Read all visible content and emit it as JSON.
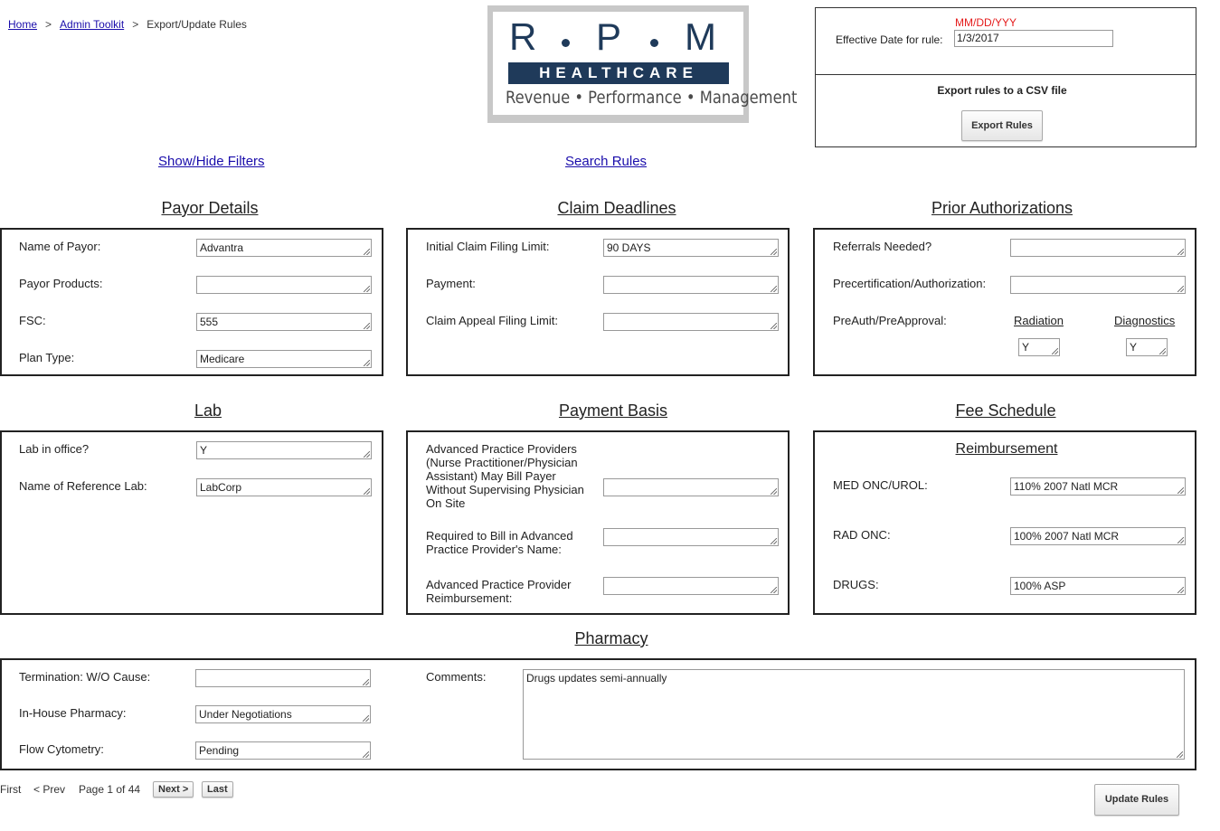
{
  "breadcrumb": {
    "home": "Home",
    "admin": "Admin Toolkit",
    "current": "Export/Update Rules",
    "sep": ">"
  },
  "logo": {
    "letters": [
      "R",
      "P",
      "M"
    ],
    "band": "HEALTHCARE",
    "tagline": "Revenue • Performance • Management"
  },
  "export": {
    "date_format": "MM/DD/YYY",
    "effective_label": "Effective Date for rule:",
    "effective_value": "1/3/2017",
    "csv_label": "Export rules to a CSV file",
    "export_button": "Export Rules"
  },
  "links": {
    "filters": "Show/Hide Filters",
    "search": "Search Rules"
  },
  "payor": {
    "title": "Payor Details",
    "fields": [
      {
        "label": "Name of Payor:",
        "value": "Advantra"
      },
      {
        "label": "Payor Products:",
        "value": ""
      },
      {
        "label": "FSC:",
        "value": "555"
      },
      {
        "label": "Plan Type:",
        "value": "Medicare"
      }
    ]
  },
  "claim": {
    "title": "Claim Deadlines",
    "fields": [
      {
        "label": "Initial Claim Filing Limit:",
        "value": "90 DAYS"
      },
      {
        "label": "Payment:",
        "value": ""
      },
      {
        "label": "Claim Appeal Filing Limit:",
        "value": ""
      }
    ]
  },
  "prior": {
    "title": "Prior Authorizations",
    "referrals_label": "Referrals Needed?",
    "referrals_value": "",
    "precert_label": "Precertification/Authorization:",
    "precert_value": "",
    "preauth_label": "PreAuth/PreApproval:",
    "radiation_label": "Radiation",
    "radiation_value": "Y",
    "diagnostics_label": "Diagnostics",
    "diagnostics_value": "Y"
  },
  "lab": {
    "title": "Lab",
    "fields": [
      {
        "label": "Lab in office?",
        "value": "Y"
      },
      {
        "label": "Name of Reference Lab:",
        "value": "LabCorp"
      }
    ]
  },
  "payment_basis": {
    "title": "Payment Basis",
    "fields": [
      {
        "label": "Advanced Practice Providers (Nurse Practitioner/Physician Assistant) May Bill Payer Without Supervising Physician On Site",
        "value": ""
      },
      {
        "label": "Required to Bill in Advanced Practice Provider's Name:",
        "value": ""
      },
      {
        "label": "Advanced Practice Provider Reimbursement:",
        "value": ""
      }
    ]
  },
  "fee": {
    "title": "Fee Schedule",
    "subtitle": "Reimbursement",
    "fields": [
      {
        "label": "MED ONC/UROL:",
        "value": "110% 2007 Natl MCR"
      },
      {
        "label": "RAD ONC:",
        "value": "100% 2007 Natl MCR"
      },
      {
        "label": "DRUGS:",
        "value": "100% ASP"
      }
    ]
  },
  "pharmacy": {
    "title": "Pharmacy",
    "fields": [
      {
        "label": "Termination: W/O Cause:",
        "value": ""
      },
      {
        "label": "In-House Pharmacy:",
        "value": "Under Negotiations"
      },
      {
        "label": "Flow Cytometry:",
        "value": "Pending"
      }
    ],
    "comments_label": "Comments:",
    "comments_value": "Drugs updates semi-annually"
  },
  "pager": {
    "first": "First",
    "prev": "< Prev",
    "page_text": "Page 1 of 44",
    "next": "Next >",
    "last": "Last"
  },
  "update_button": "Update Rules"
}
